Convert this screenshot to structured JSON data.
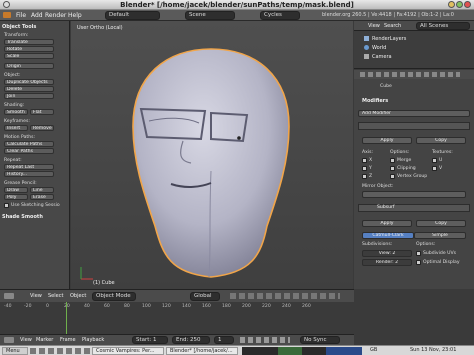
{
  "window": {
    "title": "Blender* [/home/jacek/blender/sunPaths/temp/mask.blend]"
  },
  "infobar": {
    "menus": [
      "File",
      "Add",
      "Render",
      "Help"
    ],
    "layout": "Default",
    "scene": "Scene",
    "engine": "Cycles",
    "stats": "blender.org 260.5 | Ve:4418 | Fa:4192 | Ob:1-2 | La:0"
  },
  "tools": {
    "title": "Object Tools",
    "transform_header": "Transform:",
    "translate": "Translate",
    "rotate": "Rotate",
    "scale": "Scale",
    "origin": "Origin",
    "object_header": "Object:",
    "duplicate": "Duplicate Objects",
    "delete": "Delete",
    "join": "Join",
    "shading_header": "Shading:",
    "smooth": "Smooth",
    "flat": "Flat",
    "keyframes_header": "Keyframes:",
    "insert": "Insert",
    "remove": "Remove",
    "motion_header": "Motion Paths:",
    "calc_paths": "Calculate Paths",
    "clear_paths": "Clear Paths",
    "repeat_header": "Repeat:",
    "repeat_last": "Repeat Last",
    "history": "History...",
    "grease_header": "Grease Pencil:",
    "draw": "Draw",
    "line": "Line",
    "poly": "Poly",
    "erase": "Erase",
    "use_sketching": "Use Sketching Sessio",
    "shade_smooth": "Shade Smooth"
  },
  "viewport": {
    "label": "User Ortho (Local)",
    "object": "(1) Cube"
  },
  "outliner": {
    "view": "View",
    "search": "Search",
    "all_scenes": "All Scenes",
    "items": [
      "RenderLayers",
      "World",
      "Camera"
    ]
  },
  "properties": {
    "breadcrumb": "Cube",
    "modifiers_header": "Modifiers",
    "add_modifier": "Add Modifier",
    "apply": "Apply",
    "copy": "Copy",
    "axis": "Axis:",
    "options": "Options:",
    "textures": "Textures:",
    "x": "X",
    "y": "Y",
    "z": "Z",
    "merge": "Merge",
    "clipping": "Clipping",
    "vertex_group": "Vertex Group",
    "u": "U",
    "v": "V",
    "mirror_object": "Mirror Object:",
    "subsurf": "Subsurf",
    "apply2": "Apply",
    "copy2": "Copy",
    "catmull": "Catmull-Clark",
    "simple": "Simple",
    "subdivisions": "Subdivisions:",
    "view_lvl": "View: 2",
    "render_lvl": "Render: 2",
    "options2": "Options:",
    "subdivide_uvs": "Subdivide UVs",
    "optimal_display": "Optimal Display"
  },
  "vpheader": {
    "view": "View",
    "select": "Select",
    "object": "Object",
    "mode": "Object Mode",
    "pivot": "Global"
  },
  "timeline": {
    "ticks": [
      "-40",
      "-20",
      "0",
      "20",
      "40",
      "60",
      "80",
      "100",
      "120",
      "140",
      "160",
      "180",
      "200",
      "220",
      "240",
      "260"
    ],
    "view": "View",
    "marker": "Marker",
    "frame": "Frame",
    "playback": "Playback",
    "start": "Start: 1",
    "end": "End: 250",
    "current": "1",
    "sync": "No Sync"
  },
  "taskbar": {
    "menu": "Menu",
    "tasks": [
      "Cosmic Vampires: Per...",
      "Blender* [/home/jacek/..."
    ],
    "lang": "GB",
    "clock": "Sun 13 Nov, 23:01"
  },
  "colors": {
    "accent": "#5680c2",
    "selection": "#f1a549",
    "mesh": "#b8b8c9"
  }
}
